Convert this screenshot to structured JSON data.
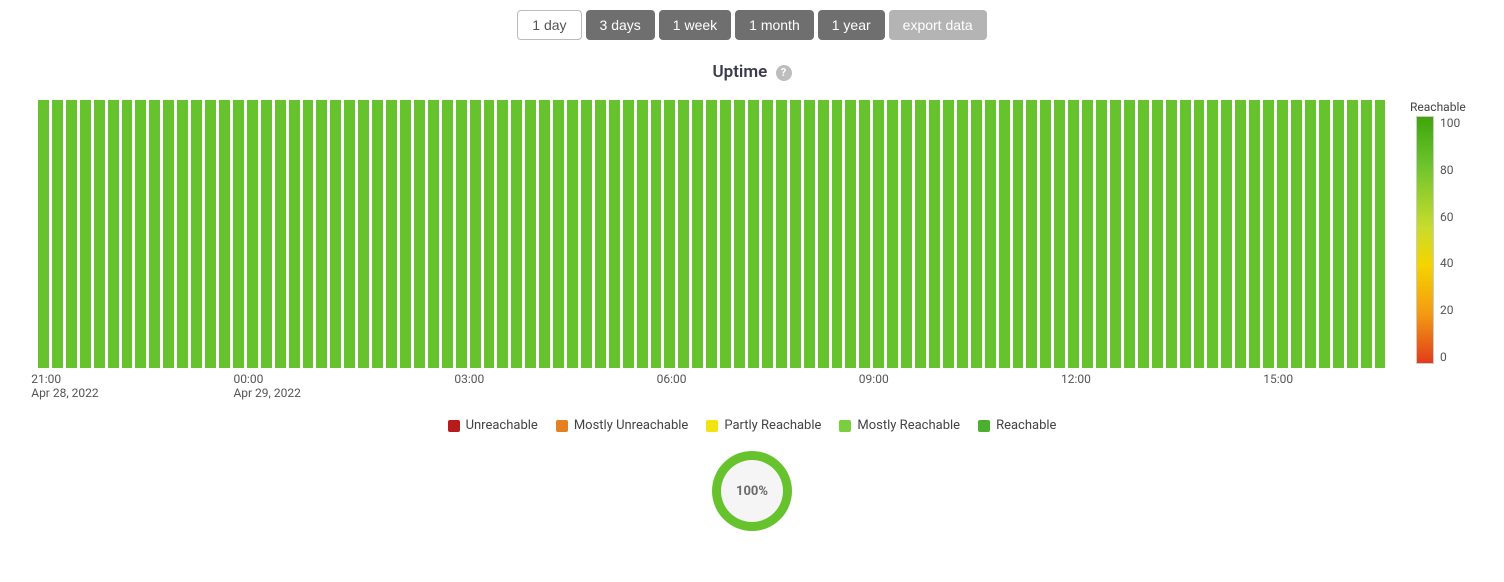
{
  "toolbar": {
    "buttons": [
      {
        "label": "1 day",
        "active": true
      },
      {
        "label": "3 days",
        "active": false
      },
      {
        "label": "1 week",
        "active": false
      },
      {
        "label": "1 month",
        "active": false
      },
      {
        "label": "1 year",
        "active": false
      }
    ],
    "export_label": "export data"
  },
  "title": "Uptime",
  "help_glyph": "?",
  "colorbar": {
    "title": "Reachable",
    "ticks": [
      "100",
      "80",
      "60",
      "40",
      "20",
      "0"
    ]
  },
  "legend": [
    {
      "label": "Unreachable",
      "color": "#b71c1c"
    },
    {
      "label": "Mostly Unreachable",
      "color": "#e67e22"
    },
    {
      "label": "Partly Reachable",
      "color": "#f1e40f"
    },
    {
      "label": "Mostly Reachable",
      "color": "#7bcf3f"
    },
    {
      "label": "Reachable",
      "color": "#4caf2f"
    }
  ],
  "donut_label": "100%",
  "chart_data": {
    "type": "bar",
    "title": "Uptime",
    "ylabel": "Reachable",
    "ylim": [
      0,
      100
    ],
    "bar_count": 97,
    "all_values": 100,
    "x_ticks": [
      {
        "pos_pct": 2.0,
        "time": "21:00",
        "date": "Apr 28, 2022"
      },
      {
        "pos_pct": 17.0,
        "time": "00:00",
        "date": "Apr 29, 2022"
      },
      {
        "pos_pct": 32.0,
        "time": "03:00",
        "date": ""
      },
      {
        "pos_pct": 47.0,
        "time": "06:00",
        "date": ""
      },
      {
        "pos_pct": 62.0,
        "time": "09:00",
        "date": ""
      },
      {
        "pos_pct": 77.0,
        "time": "12:00",
        "date": ""
      },
      {
        "pos_pct": 92.0,
        "time": "15:00",
        "date": ""
      }
    ],
    "colorbar_ticks": [
      100,
      80,
      60,
      40,
      20,
      0
    ],
    "uptime_percent": 100
  }
}
